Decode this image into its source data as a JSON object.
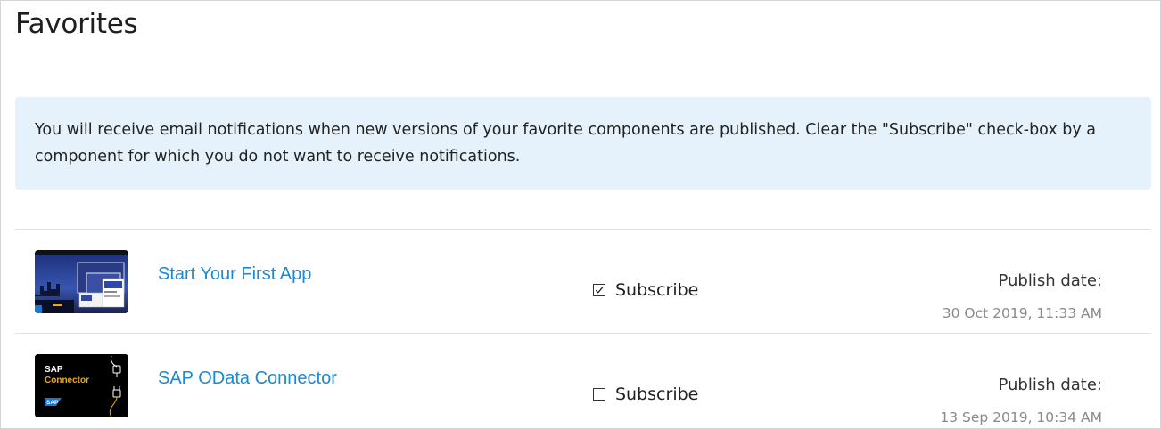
{
  "page": {
    "title": "Favorites"
  },
  "info": {
    "text": "You will receive email notifications when new versions of your favorite components are published. Clear the \"Subscribe\" check-box by a component for which you do not want to receive notifications."
  },
  "favorites": [
    {
      "name": "Start Your First App",
      "thumbnail_icon": "app-screenshot-thumbnail",
      "subscribe_label": "Subscribe",
      "subscribed": true,
      "publish_label": "Publish date:",
      "publish_date": "30 Oct 2019, 11:33 AM"
    },
    {
      "name": "SAP OData Connector",
      "thumbnail_icon": "sap-connector-logo",
      "thumbnail_text_line1": "SAP",
      "thumbnail_text_line2": "Connector",
      "thumbnail_badge": "SAP",
      "subscribe_label": "Subscribe",
      "subscribed": false,
      "publish_label": "Publish date:",
      "publish_date": "13 Sep 2019, 10:34 AM"
    }
  ],
  "colors": {
    "link": "#1a8ad4",
    "info_background": "#e5f2fb",
    "date_text": "#8a8a8a",
    "sap_accent": "#f0ab00"
  }
}
